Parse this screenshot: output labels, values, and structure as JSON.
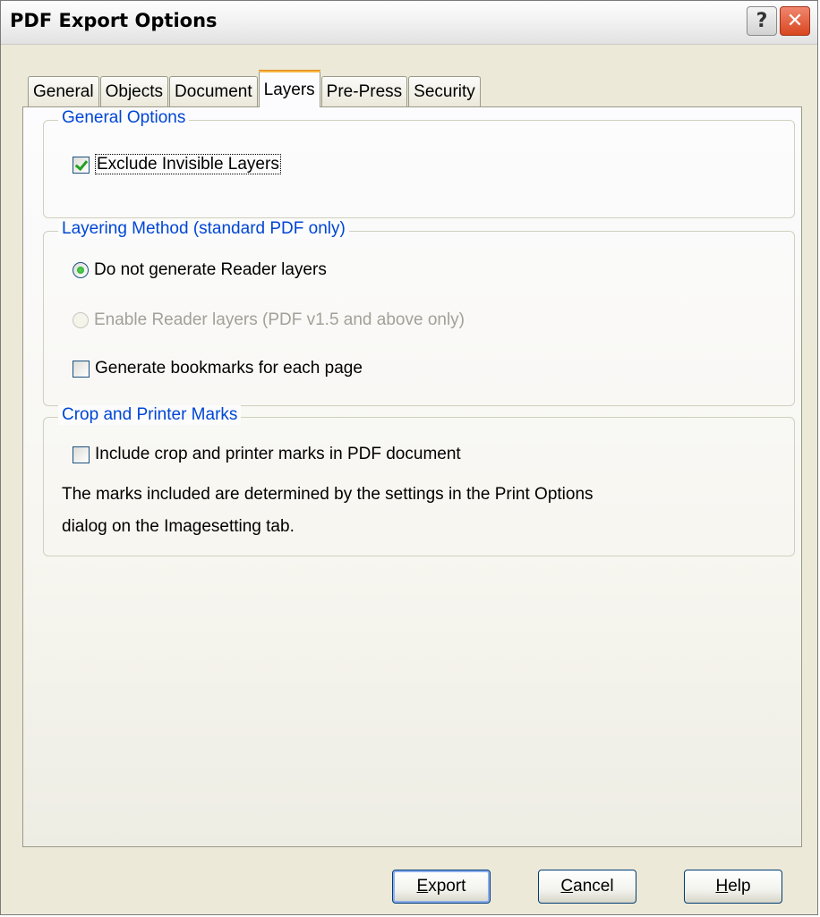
{
  "window": {
    "title": "PDF Export Options"
  },
  "titlebar_buttons": {
    "help": "?",
    "close": "✕"
  },
  "tabs": [
    {
      "label": "General",
      "active": false
    },
    {
      "label": "Objects",
      "active": false
    },
    {
      "label": "Document",
      "active": false
    },
    {
      "label": "Layers",
      "active": true
    },
    {
      "label": "Pre-Press",
      "active": false
    },
    {
      "label": "Security",
      "active": false
    }
  ],
  "general_options": {
    "legend": "General Options",
    "exclude_invisible_layers": {
      "label": "Exclude Invisible Layers",
      "checked": true
    }
  },
  "layering_method": {
    "legend": "Layering Method (standard PDF only)",
    "do_not_generate": {
      "label": "Do not generate Reader layers",
      "selected": true
    },
    "enable_reader_layers": {
      "label": "Enable Reader layers (PDF v1.5 and above only)",
      "selected": false,
      "enabled": false
    },
    "generate_bookmarks": {
      "label": "Generate bookmarks for each page",
      "checked": false
    }
  },
  "crop_marks": {
    "legend": "Crop and Printer Marks",
    "include_marks": {
      "label": "Include crop and printer marks in PDF document",
      "checked": false
    },
    "note_line1": "The marks included are determined by the settings in the Print Options",
    "note_line2": "dialog on the Imagesetting tab."
  },
  "buttons": {
    "export": {
      "prefix": "",
      "mnemonic": "E",
      "rest": "xport"
    },
    "cancel": {
      "prefix": "",
      "mnemonic": "C",
      "rest": "ancel"
    },
    "help": {
      "prefix": "",
      "mnemonic": "H",
      "rest": "elp"
    }
  },
  "colors": {
    "legend_text": "#0046d5",
    "active_tab_highlight": "#f6b642",
    "close_button": "#d8461f",
    "check_mark": "#21a121"
  }
}
